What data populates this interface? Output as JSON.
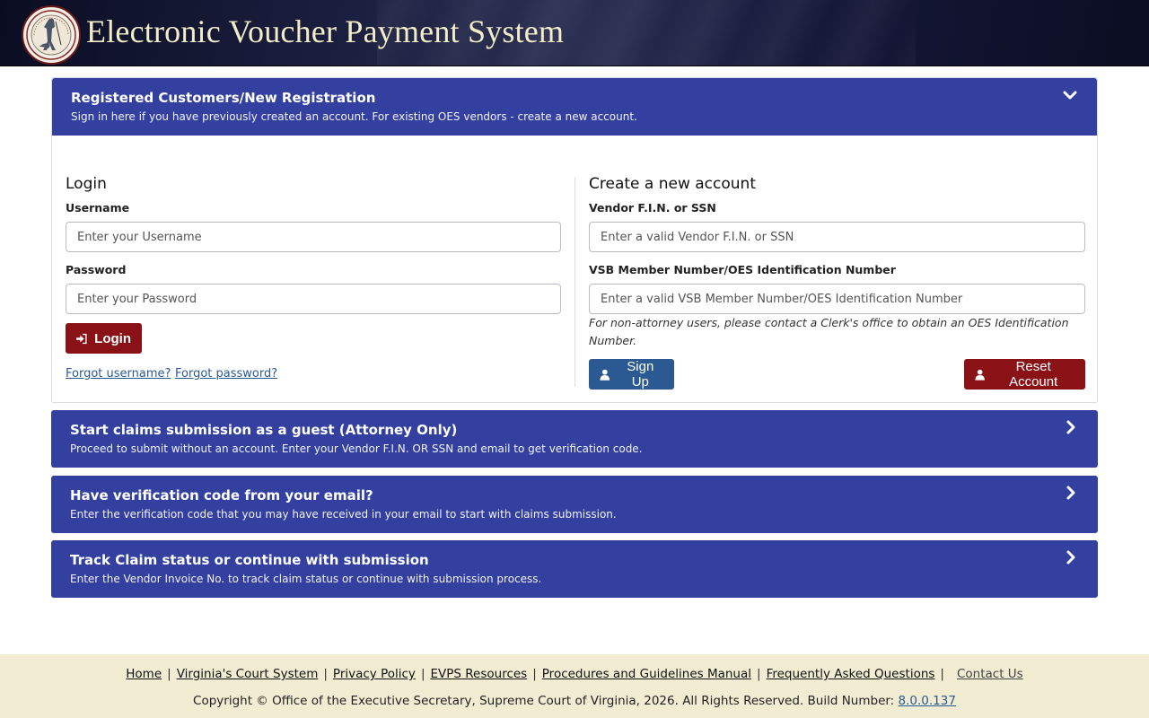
{
  "header": {
    "title": "Electronic Voucher Payment System",
    "seal_icon": "virginia-seal-icon"
  },
  "registered_panel": {
    "title": "Registered Customers/New Registration",
    "subtitle": "Sign in here if you have previously created an account. For existing OES vendors - create a new account.",
    "expanded": true,
    "login": {
      "heading": "Login",
      "username_label": "Username",
      "username_placeholder": "Enter your Username",
      "username_value": "",
      "password_label": "Password",
      "password_placeholder": "Enter your Password",
      "password_value": "",
      "login_button": "Login",
      "forgot_username": "Forgot username?",
      "forgot_password": "Forgot password?"
    },
    "create": {
      "heading": "Create a new account",
      "vendor_label": "Vendor F.I.N. or SSN",
      "vendor_placeholder": "Enter a valid Vendor F.I.N. or SSN",
      "vendor_value": "",
      "vsb_label": "VSB Member Number/OES Identification Number",
      "vsb_placeholder": "Enter a valid VSB Member Number/OES Identification Number",
      "vsb_value": "",
      "note": "For non-attorney users, please contact a Clerk's office to obtain an OES Identification Number.",
      "signup_button": "Sign Up",
      "reset_button": "Reset Account"
    }
  },
  "guest_panel": {
    "title": "Start claims submission as a guest (Attorney Only)",
    "subtitle": "Proceed to submit without an account. Enter your Vendor F.I.N. OR SSN and email to get verification code."
  },
  "verify_panel": {
    "title": "Have verification code from your email?",
    "subtitle": "Enter the verification code that you may have received in your email to start with claims submission."
  },
  "track_panel": {
    "title": "Track Claim status or continue with submission",
    "subtitle": "Enter the Vendor Invoice No. to track claim status or continue with submission process."
  },
  "footer": {
    "links": [
      "Home",
      "Virginia's Court System",
      "Privacy Policy",
      "EVPS Resources",
      "Procedures and Guidelines Manual",
      "Frequently Asked Questions"
    ],
    "contact": "Contact Us",
    "copyright": "Copyright © Office of the Executive Secretary, Supreme Court of Virginia, 2026. All Rights Reserved. Build Number:",
    "build_number": "8.0.0.137"
  },
  "colors": {
    "panel_blue": "#3340a0",
    "button_red": "#8a1216",
    "button_blue": "#2b5a93",
    "footer_bg": "#f1ecd2",
    "title_cream": "#f3ecc8"
  }
}
